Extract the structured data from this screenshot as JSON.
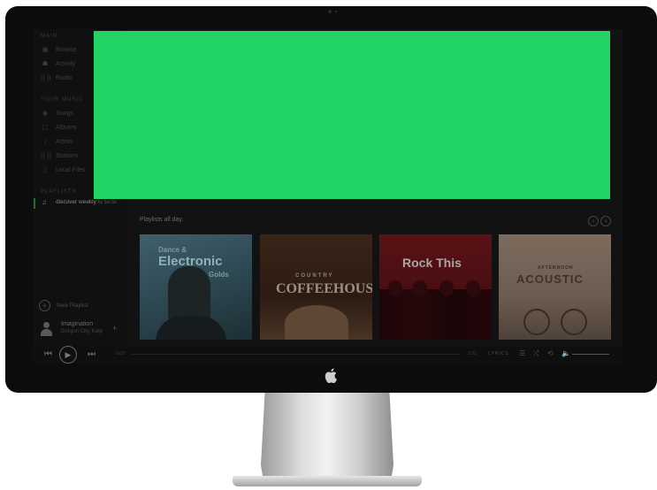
{
  "sidebar": {
    "sections": {
      "main": "MAIN",
      "your_music": "YOUR MUSIC",
      "playlists": "PLAYLISTS"
    },
    "main_items": [
      {
        "label": "Browse",
        "icon": "browse-icon"
      },
      {
        "label": "Activity",
        "icon": "activity-icon"
      },
      {
        "label": "Radio",
        "icon": "radio-icon"
      }
    ],
    "music_items": [
      {
        "label": "Songs",
        "icon": "songs-icon"
      },
      {
        "label": "Albums",
        "icon": "albums-icon"
      },
      {
        "label": "Artists",
        "icon": "artists-icon"
      },
      {
        "label": "Stations",
        "icon": "stations-icon"
      },
      {
        "label": "Local Files",
        "icon": "local-files-icon"
      }
    ],
    "playlist_active": {
      "name": "discover weekly",
      "by": "by Sol Sh"
    },
    "new_playlist": "New Playlist",
    "now_playing": {
      "title": "Imagination",
      "artist": "Gorgon City, Katy"
    }
  },
  "main": {
    "row_title": "Playlists all day.",
    "cards": [
      {
        "line1": "Dance &",
        "line2": "Electronic",
        "line3": "Golds"
      },
      {
        "line1": "COUNTRY",
        "line2": "COFFEEHOUSE"
      },
      {
        "line1": "Rock This"
      },
      {
        "line1": "AFTERNOON",
        "line2": "ACOUSTIC"
      }
    ]
  },
  "player": {
    "elapsed": "0:00",
    "remaining": "3:31",
    "lyrics_label": "LYRICS"
  },
  "colors": {
    "accent_green": "#21d464",
    "bezel": "#0c0c0c",
    "screen_bg": "#121212"
  }
}
